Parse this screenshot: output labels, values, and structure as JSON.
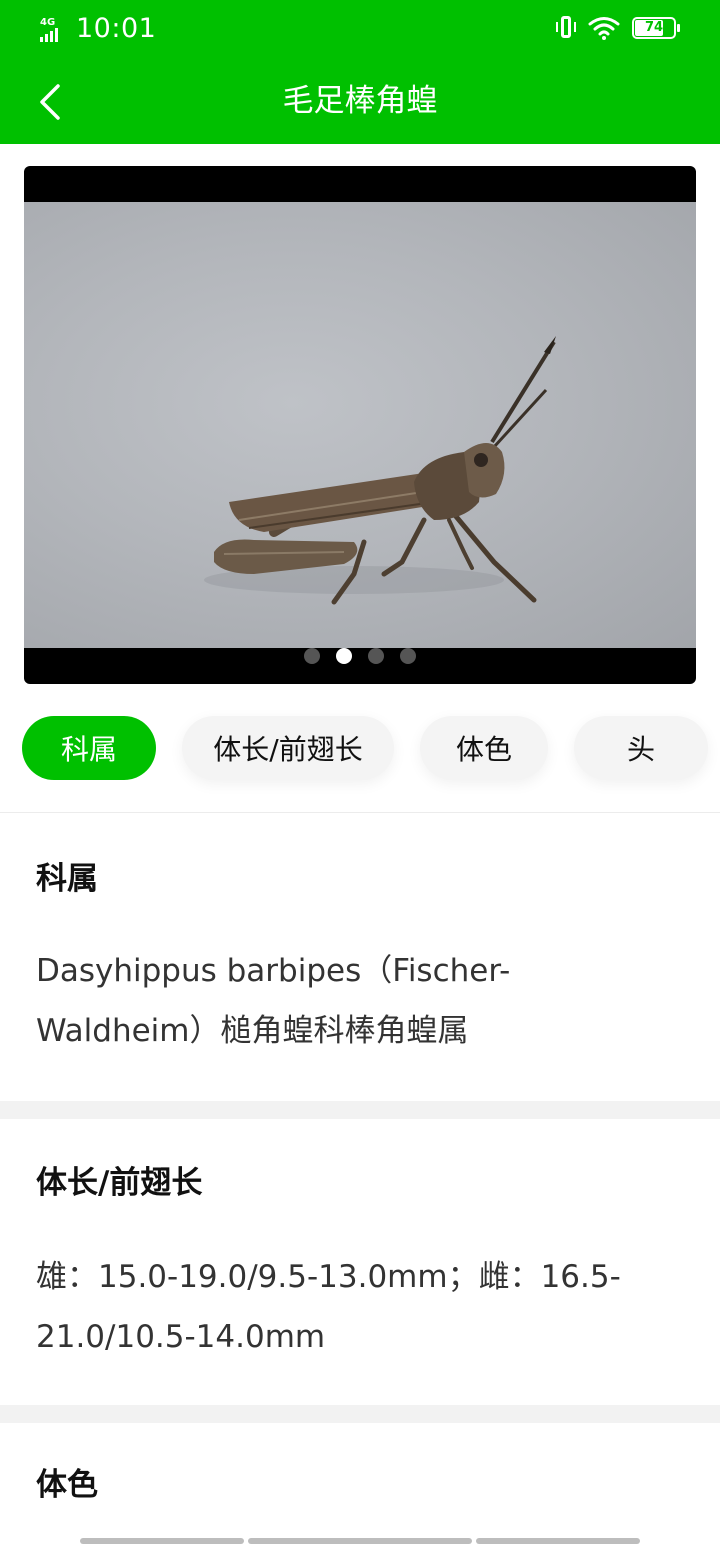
{
  "status_bar": {
    "network": "4G",
    "time": "10:01",
    "battery_level": "74"
  },
  "header": {
    "title": "毛足棒角蝗",
    "back_icon": "chevron-left-icon"
  },
  "gallery": {
    "image_count": 4,
    "active_index": 1
  },
  "tabs": [
    {
      "label": "科属",
      "active": true
    },
    {
      "label": "体长/前翅长",
      "active": false
    },
    {
      "label": "体色",
      "active": false
    },
    {
      "label": "头",
      "active": false
    }
  ],
  "sections": {
    "family": {
      "heading": "科属",
      "line1": "Dasyhippus barbipes（Fischer-",
      "line2": "Waldheim）槌角蝗科棒角蝗属"
    },
    "length": {
      "heading": "体长/前翅长",
      "line1": "雄：15.0-19.0/9.5-13.0mm；雌：16.5-",
      "line2": "21.0/10.5-14.0mm"
    },
    "color": {
      "heading": "体色"
    }
  },
  "colors": {
    "accent": "#00c000",
    "text": "#111111",
    "body_text": "#333333"
  }
}
